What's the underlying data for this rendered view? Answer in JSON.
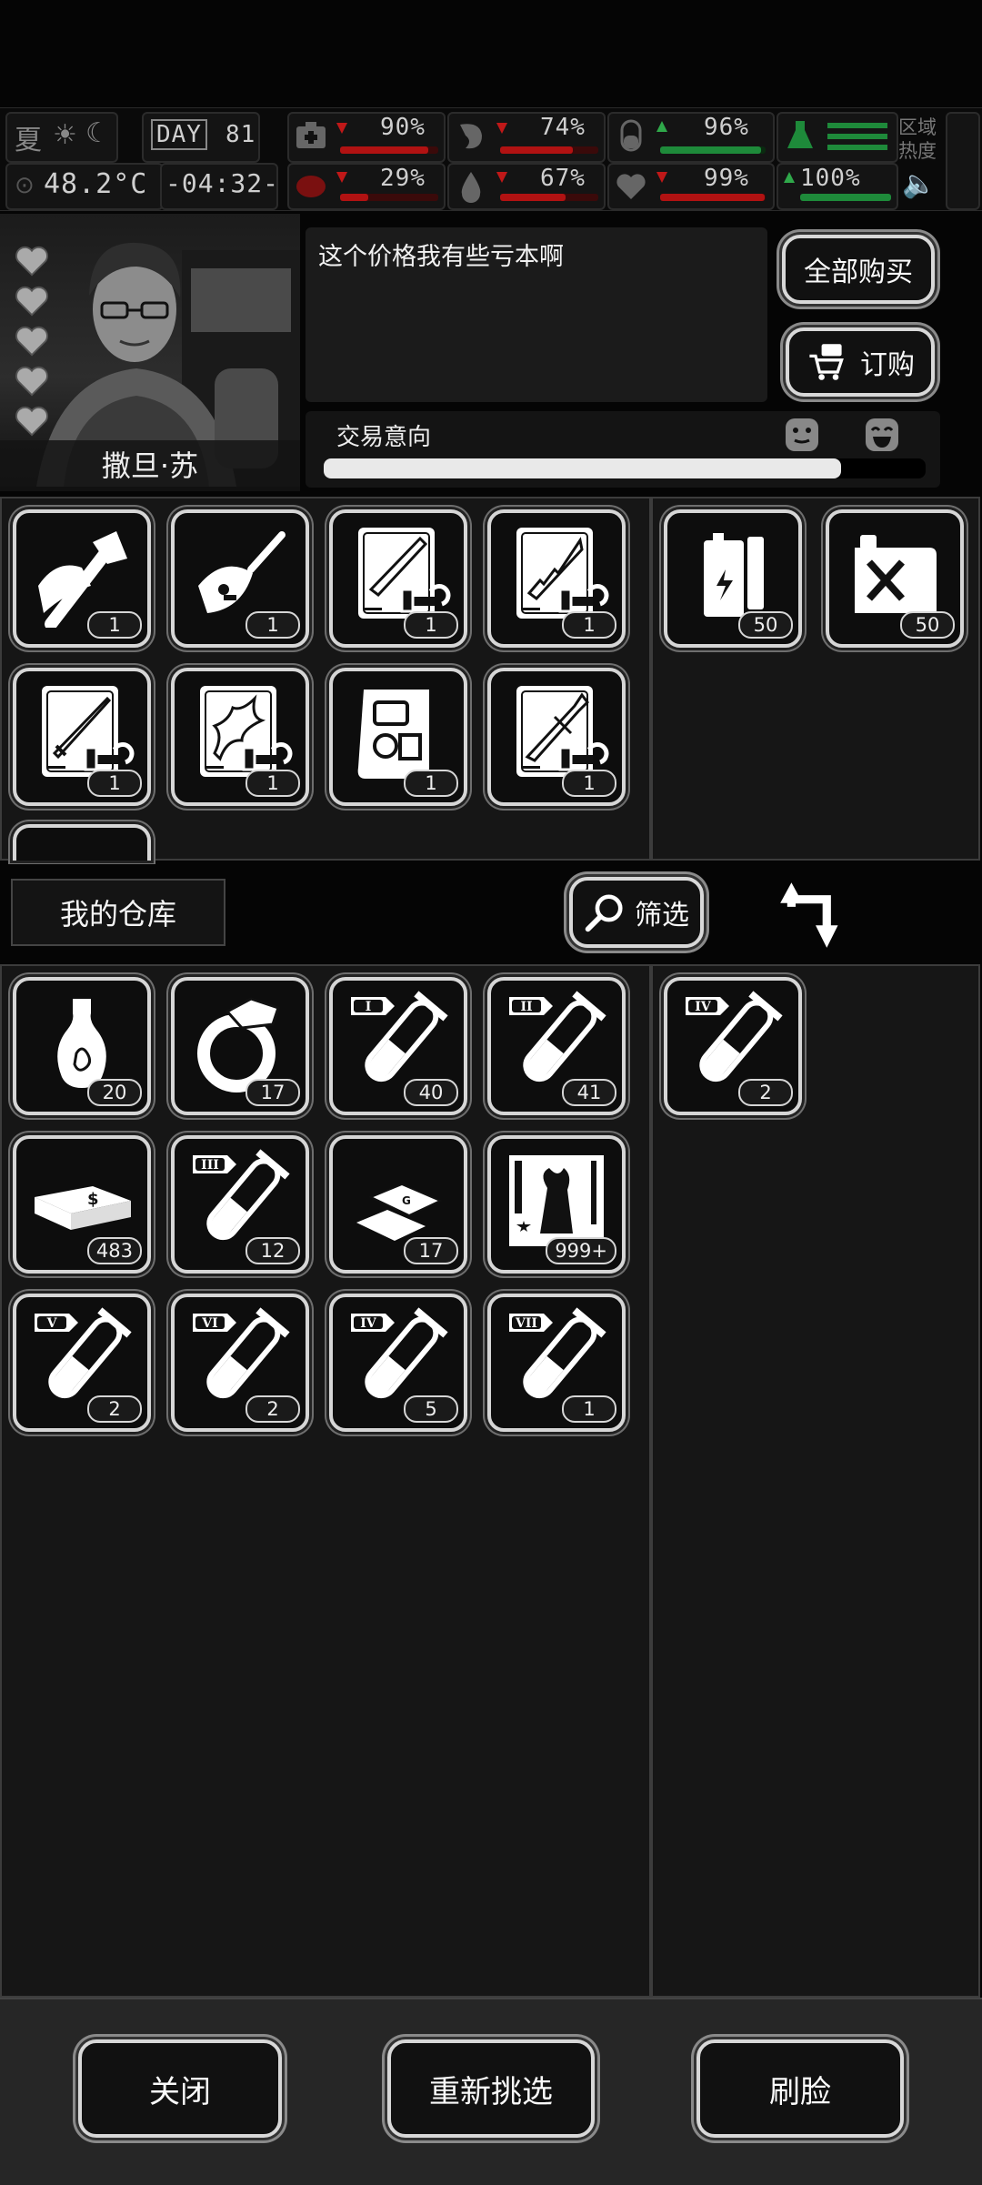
{
  "status": {
    "season": "夏",
    "day_label": "DAY",
    "day_number": "81",
    "temperature": "48.2°C",
    "clock": "-04:32-",
    "stats": [
      {
        "name": "health",
        "value": "90%",
        "icon": "medkit-icon",
        "level": 0.9
      },
      {
        "name": "stamina",
        "value": "74%",
        "icon": "stomach-icon",
        "level": 0.74
      },
      {
        "name": "mood",
        "value": "96%",
        "icon": "brain-icon",
        "level": 0.96,
        "trend": "up"
      },
      {
        "name": "water",
        "value": "29%",
        "icon": "drop-icon",
        "level": 0.29
      },
      {
        "name": "hydration",
        "value": "67%",
        "icon": "drop-icon",
        "level": 0.67
      },
      {
        "name": "vitality",
        "value": "99%",
        "icon": "heart-icon",
        "level": 0.99,
        "trend": "up"
      },
      {
        "name": "energy",
        "value": "100%",
        "icon": "flask-icon",
        "level": 1.0,
        "trend": "up"
      }
    ],
    "region_label": "区域热度"
  },
  "trader": {
    "name": "撒旦·苏",
    "dialogue": "这个价格我有些亏本啊",
    "intent_label": "交易意向",
    "intent_level": 0.86,
    "hearts": 5
  },
  "buttons": {
    "buy_all": "全部购买",
    "order": "订购",
    "filter": "筛选",
    "close": "关闭",
    "reselect": "重新挑选",
    "face": "刷脸"
  },
  "warehouse_label": "我的仓库",
  "shop_items": [
    {
      "icon": "hatchet-icon",
      "count": "1"
    },
    {
      "icon": "car-key-icon",
      "count": "1"
    },
    {
      "icon": "blade-blueprint-icon",
      "count": "1"
    },
    {
      "icon": "serrated-blade-blueprint-icon",
      "count": "1"
    },
    {
      "icon": "sword-blueprint-icon",
      "count": "1"
    },
    {
      "icon": "jagged-blade-blueprint-icon",
      "count": "1"
    },
    {
      "icon": "engine-scroll-icon",
      "count": "1"
    },
    {
      "icon": "greatsword-blueprint-icon",
      "count": "1"
    }
  ],
  "shop_side_items": [
    {
      "icon": "battery-icon",
      "count": "50"
    },
    {
      "icon": "fuel-can-icon",
      "count": "50"
    }
  ],
  "warehouse_items": [
    {
      "icon": "vase-icon",
      "count": "20"
    },
    {
      "icon": "ring-icon",
      "count": "17"
    },
    {
      "icon": "test-tube-icon",
      "tier": "I",
      "count": "40"
    },
    {
      "icon": "test-tube-icon",
      "tier": "II",
      "count": "41"
    },
    {
      "icon": "cash-bundle-icon",
      "count": "483"
    },
    {
      "icon": "test-tube-icon",
      "tier": "III",
      "count": "12"
    },
    {
      "icon": "gold-bars-icon",
      "count": "17"
    },
    {
      "icon": "zombie-card-icon",
      "count": "999+"
    },
    {
      "icon": "test-tube-icon",
      "tier": "V",
      "count": "2"
    },
    {
      "icon": "test-tube-icon",
      "tier": "VI",
      "count": "2"
    },
    {
      "icon": "test-tube-icon",
      "tier": "IV",
      "count": "5"
    },
    {
      "icon": "test-tube-icon",
      "tier": "VII",
      "count": "1"
    }
  ],
  "warehouse_side_items": [
    {
      "icon": "test-tube-icon",
      "tier": "IV",
      "count": "2"
    }
  ]
}
